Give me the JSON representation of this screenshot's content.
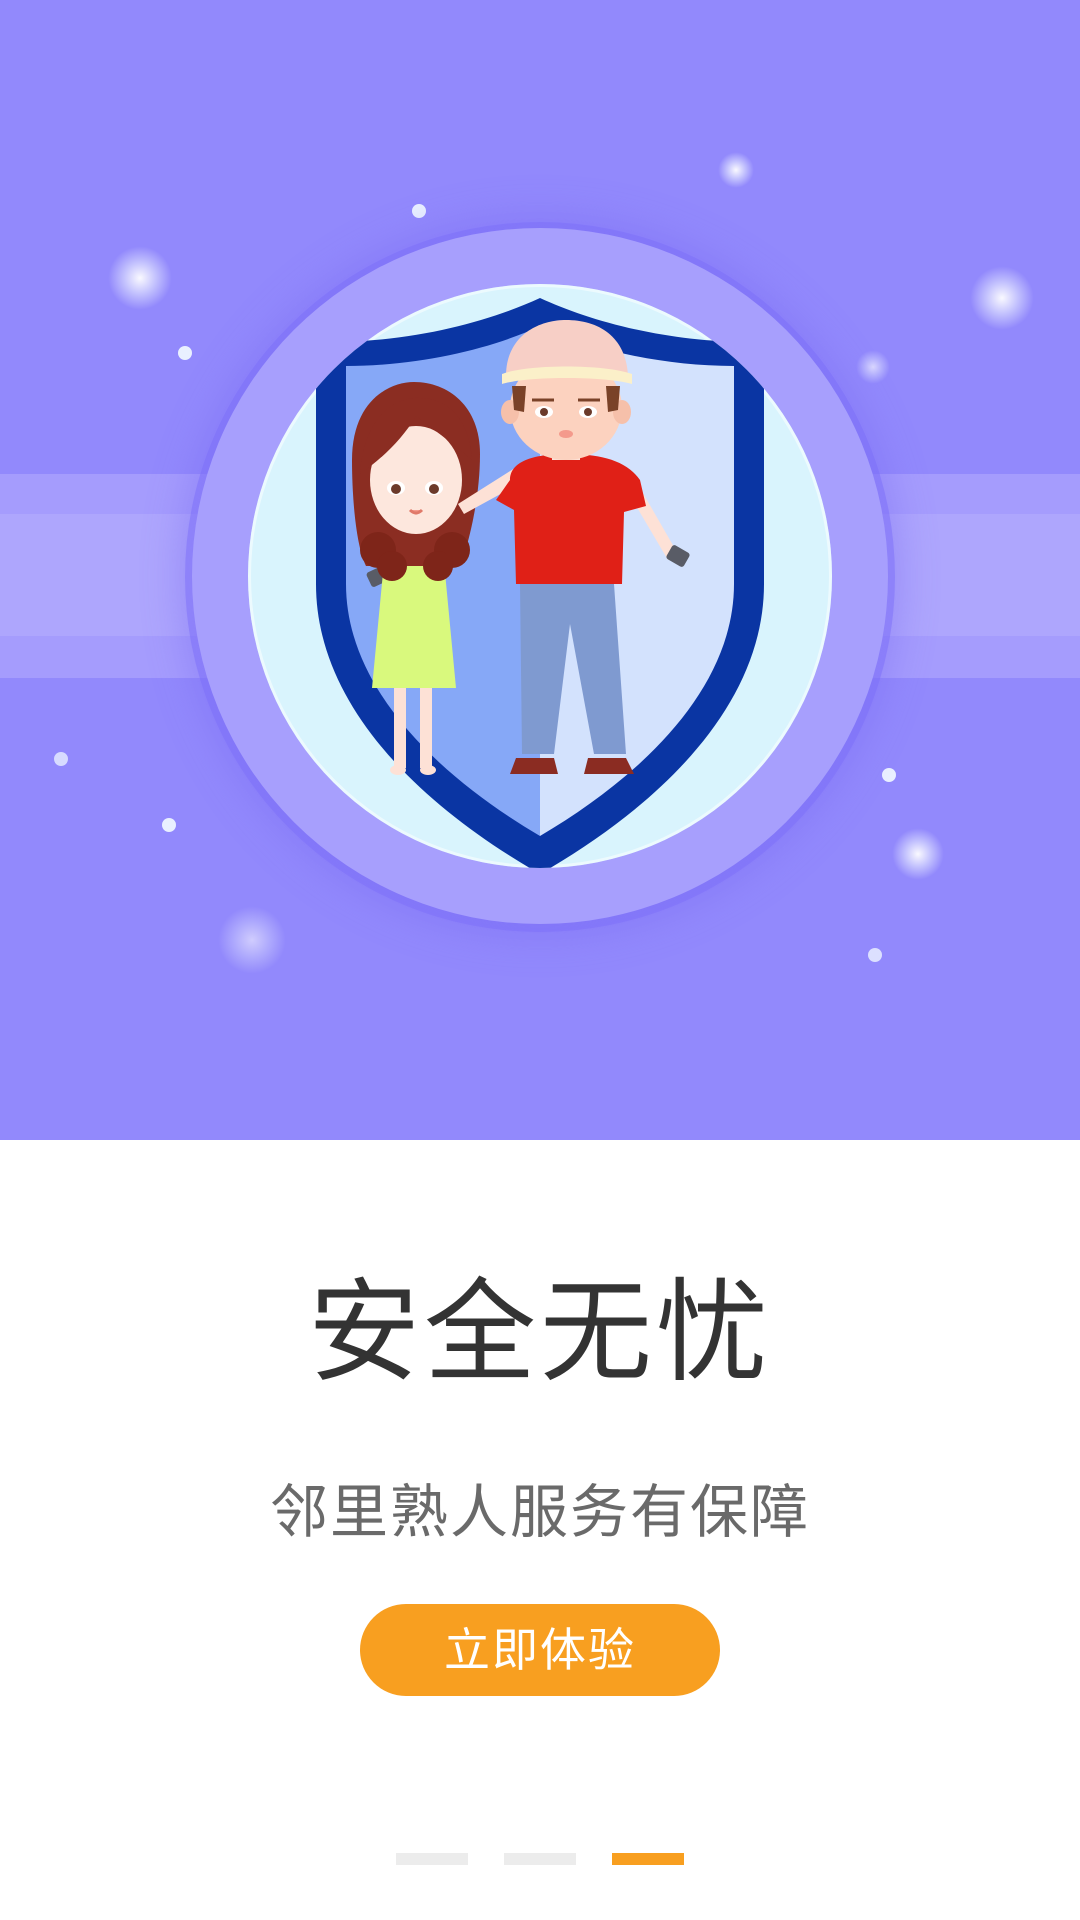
{
  "hero": {
    "background": "#9289fc",
    "illustration": "shield-with-couple-illustration"
  },
  "slide": {
    "title": "安全无忧",
    "subtitle": "邻里熟人服务有保障",
    "cta_label": "立即体验"
  },
  "pager": {
    "total": 3,
    "active_index": 2
  },
  "colors": {
    "accent": "#f89f20",
    "title_text": "#333333",
    "subtitle_text": "#6a6a6a",
    "inactive_indicator": "#ececec"
  }
}
